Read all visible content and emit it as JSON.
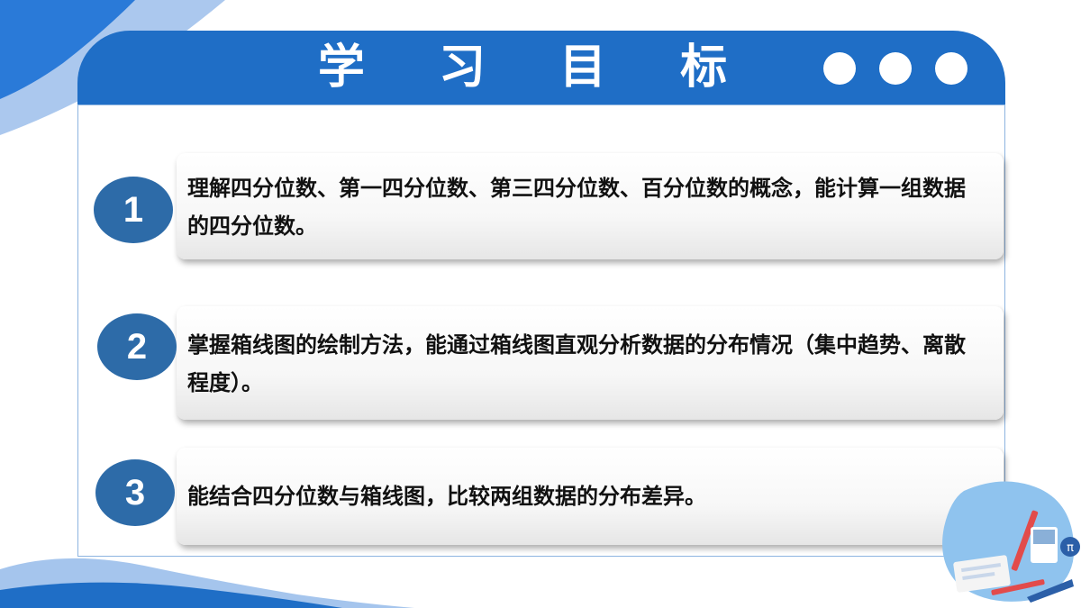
{
  "header": {
    "title": "学 习 目 标",
    "dots": [
      "dot",
      "dot",
      "dot"
    ]
  },
  "goals": [
    {
      "number": "1",
      "text": "理解四分位数、第一四分位数、第三四分位数、百分位数的概念，能计算一组数据的四分位数。"
    },
    {
      "number": "2",
      "text": "掌握箱线图的绘制方法，能通过箱线图直观分析数据的分布情况（集中趋势、离散程度）。"
    },
    {
      "number": "3",
      "text": "能结合四分位数与箱线图，比较两组数据的分布差异。"
    }
  ],
  "colors": {
    "primary": "#1f6ec6",
    "circle": "#2d6ba8",
    "light_wave": "#8fb6e8",
    "frame_border": "#8db4e0"
  },
  "decorations": {
    "corner_illustration": "math-study-illustration-icon"
  }
}
